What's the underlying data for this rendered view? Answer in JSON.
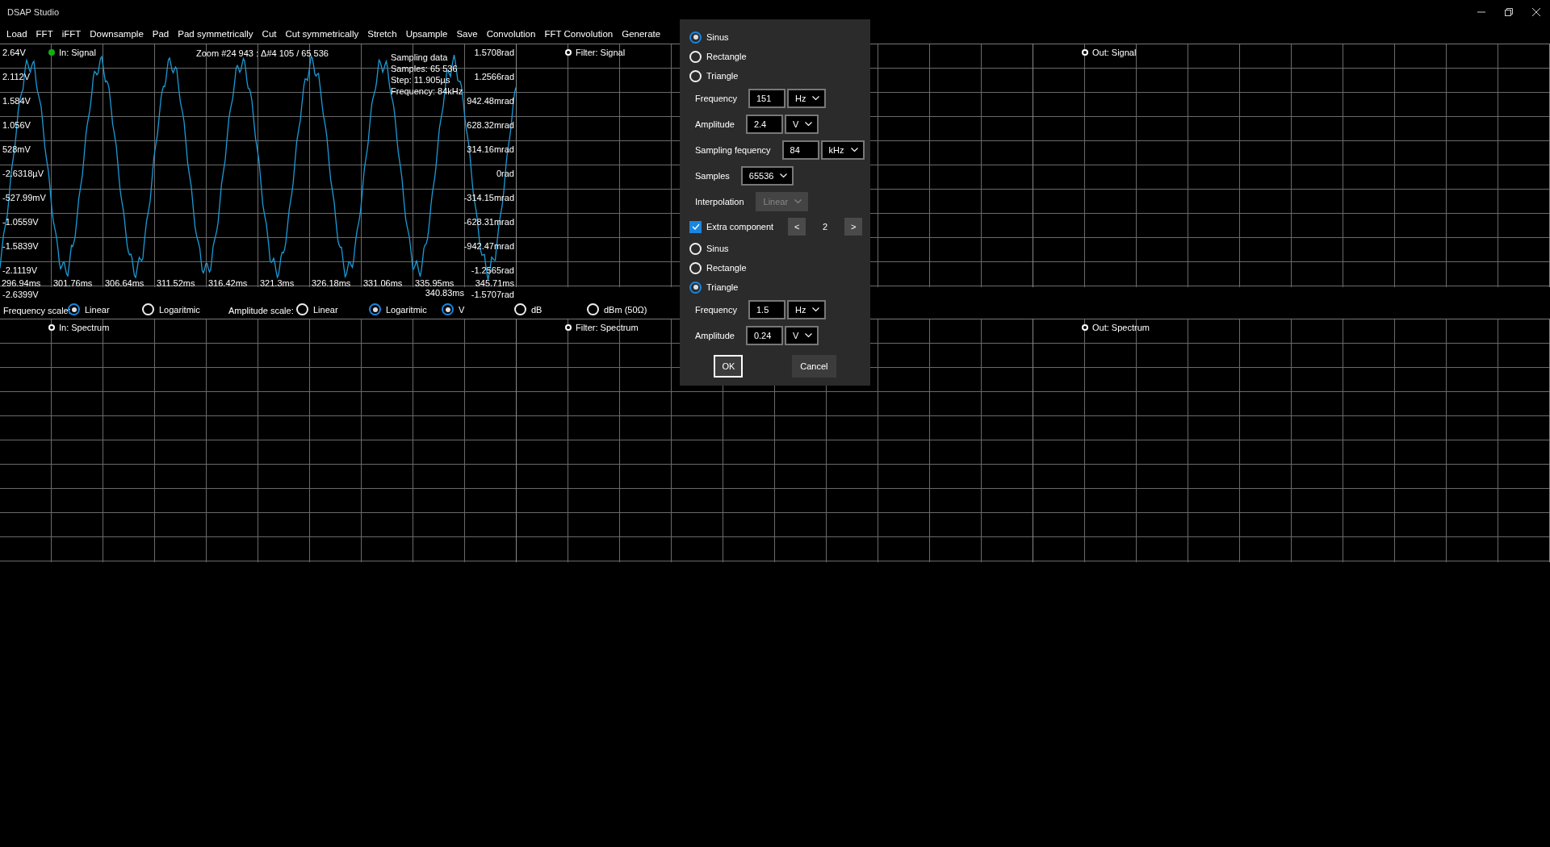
{
  "window": {
    "title": "DSAP Studio"
  },
  "menu": [
    "Load",
    "FFT",
    "iFFT",
    "Downsample",
    "Pad",
    "Pad symmetrically",
    "Cut",
    "Cut symmetrically",
    "Stretch",
    "Upsample",
    "Save",
    "Convolution",
    "FFT Convolution",
    "Generate"
  ],
  "signal_charts": [
    {
      "legend": "In: Signal",
      "active": true,
      "kind": "trace",
      "zoom": "Zoom #24 943 : Δ#4 105 / 65 536",
      "info": [
        "Sampling data",
        "Samples: 65 536",
        "Step: 11.905µs",
        "Frequency: 84kHz"
      ],
      "y_labels": [
        "2.64V",
        "2.112V",
        "1.584V",
        "1.056V",
        "528mV",
        "-2.6318µV",
        "-527.99mV",
        "-1.0559V",
        "-1.5839V",
        "-2.1119V",
        "-2.6399V"
      ],
      "y2_labels": [
        "1.5708rad",
        "1.2566rad",
        "942.48mrad",
        "628.32mrad",
        "314.16mrad",
        "0rad",
        "-314.15mrad",
        "-628.31mrad",
        "-942.47mrad",
        "-1.2565rad",
        "-1.5707rad"
      ],
      "x_labels": [
        "296.94ms",
        "301.76ms",
        "306.64ms",
        "311.52ms",
        "316.42ms",
        "321.3ms",
        "326.18ms",
        "331.06ms",
        "335.95ms",
        "340.83ms",
        "345.71ms"
      ]
    },
    {
      "legend": "Filter: Signal",
      "active": false,
      "kind": "empty"
    },
    {
      "legend": "Out: Signal",
      "active": false,
      "kind": "empty"
    }
  ],
  "scale_bar": {
    "frequency_label": "Frequency scale:",
    "frequency_options": [
      {
        "label": "Linear",
        "selected": true
      },
      {
        "label": "Logaritmic",
        "selected": false
      }
    ],
    "amplitude_label": "Amplitude scale:",
    "amplitude_options": [
      {
        "label": "Linear",
        "selected": false
      },
      {
        "label": "Logaritmic",
        "selected": true
      }
    ],
    "unit_options": [
      {
        "label": "V",
        "selected": true
      },
      {
        "label": "dB",
        "selected": false
      },
      {
        "label": "dBm (50Ω)",
        "selected": false
      }
    ]
  },
  "spectrum_charts": [
    {
      "legend": "In: Spectrum",
      "active": false,
      "kind": "empty"
    },
    {
      "legend": "Filter: Spectrum",
      "active": false,
      "kind": "empty"
    },
    {
      "legend": "Out: Spectrum",
      "active": false,
      "kind": "empty"
    }
  ],
  "dialog": {
    "waveforms": [
      {
        "label": "Sinus",
        "selected": true
      },
      {
        "label": "Rectangle",
        "selected": false
      },
      {
        "label": "Triangle",
        "selected": false
      }
    ],
    "fields": [
      {
        "kind": "input",
        "label": "Frequency",
        "value": "151",
        "unit": "Hz"
      },
      {
        "kind": "input",
        "label": "Amplitude",
        "value": "2.4",
        "unit": "V"
      },
      {
        "kind": "input",
        "label": "Sampling fequency",
        "value": "84",
        "unit": "kHz"
      },
      {
        "kind": "select",
        "label": "Samples",
        "value": "65536",
        "disabled": false
      },
      {
        "kind": "select",
        "label": "Interpolation",
        "value": "Linear",
        "disabled": true
      }
    ],
    "extra": {
      "label": "Extra component",
      "checked": true,
      "prev": "<",
      "count": "2",
      "next": ">"
    },
    "extra_waveforms": [
      {
        "label": "Sinus",
        "selected": false
      },
      {
        "label": "Rectangle",
        "selected": false
      },
      {
        "label": "Triangle",
        "selected": true
      }
    ],
    "extra_fields": [
      {
        "kind": "input",
        "label": "Frequency",
        "value": "1.5",
        "unit": "Hz"
      },
      {
        "kind": "input",
        "label": "Amplitude",
        "value": "0.24",
        "unit": "V"
      }
    ],
    "buttons": [
      {
        "label": "OK",
        "focused": true
      },
      {
        "label": "Cancel",
        "focused": false
      }
    ]
  }
}
